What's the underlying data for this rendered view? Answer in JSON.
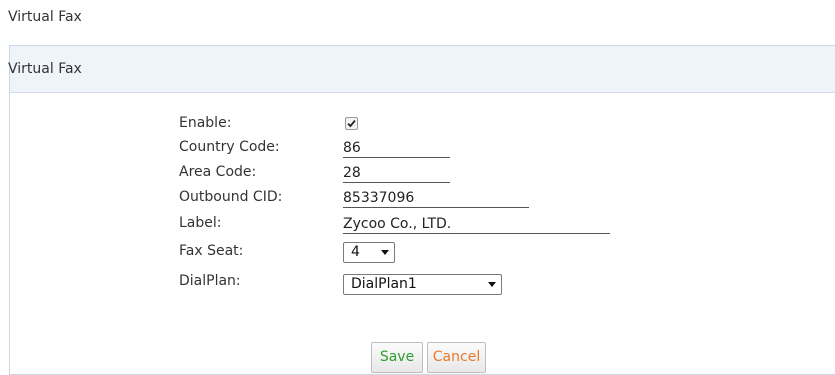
{
  "page": {
    "title": "Virtual Fax"
  },
  "panel": {
    "header": "Virtual Fax"
  },
  "form": {
    "enable": {
      "label": "Enable:",
      "checked": true
    },
    "country_code": {
      "label": "Country Code:",
      "value": "86"
    },
    "area_code": {
      "label": "Area Code:",
      "value": "28"
    },
    "outbound_cid": {
      "label": "Outbound CID:",
      "value": "85337096"
    },
    "label_field": {
      "label": "Label:",
      "value": "Zycoo Co., LTD."
    },
    "fax_seat": {
      "label": "Fax Seat:",
      "selected": "4"
    },
    "dialplan": {
      "label": "DialPlan:",
      "selected": "DialPlan1"
    }
  },
  "buttons": {
    "save_label": "Save",
    "cancel_label": "Cancel"
  },
  "colors": {
    "save_text": "#2e9e2e",
    "cancel_text": "#e8782a",
    "panel_header_bg": "#eef4fa",
    "panel_border": "#c9d7e6"
  },
  "icons": {
    "checkmark": "checkmark-icon",
    "dropdown": "chevron-down-icon"
  }
}
